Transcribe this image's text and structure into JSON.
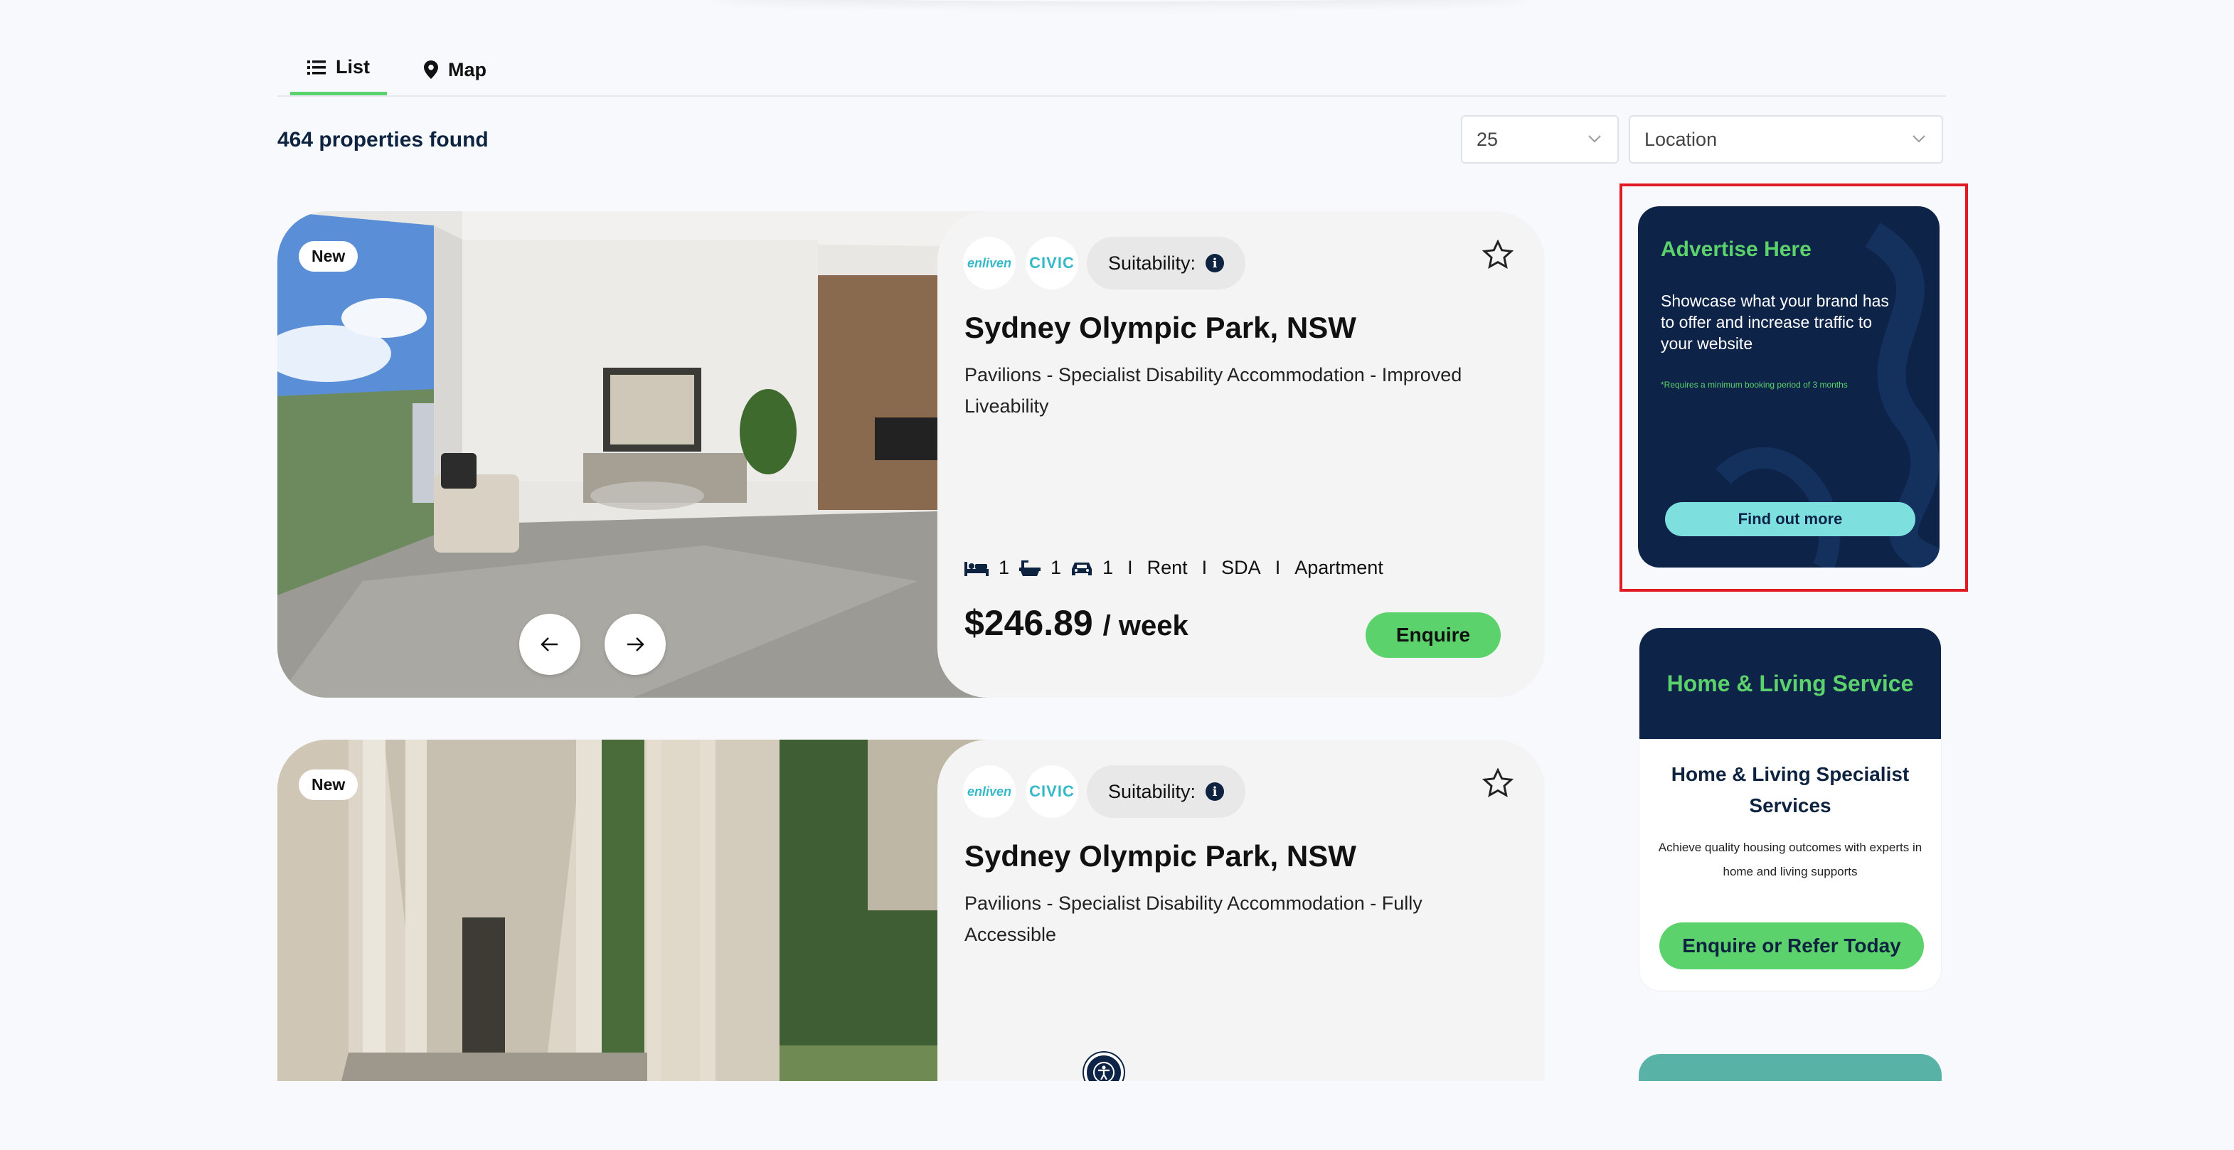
{
  "tabs": [
    {
      "label": "List",
      "icon": "list-icon",
      "active": true
    },
    {
      "label": "Map",
      "icon": "map-pin-icon",
      "active": false
    }
  ],
  "results": {
    "count_text": "464 properties found"
  },
  "filters": {
    "page_size": "25",
    "location_placeholder": "Location"
  },
  "listings": [
    {
      "badge": "New",
      "provider_logos": [
        "enliven",
        "CIVIC"
      ],
      "suitability_label": "Suitability:",
      "title": "Sydney Olympic Park, NSW",
      "description": "Pavilions - Specialist Disability Accommodation - Improved Liveability",
      "beds": "1",
      "baths": "1",
      "cars": "1",
      "tags": [
        "Rent",
        "SDA",
        "Apartment"
      ],
      "price": "$246.89",
      "price_unit": "/ week",
      "cta": "Enquire"
    },
    {
      "badge": "New",
      "provider_logos": [
        "enliven",
        "CIVIC"
      ],
      "suitability_label": "Suitability:",
      "title": "Sydney Olympic Park, NSW",
      "description": "Pavilions - Specialist Disability Accommodation - Fully Accessible"
    }
  ],
  "ads": {
    "advertise": {
      "title": "Advertise Here",
      "body": "Showcase what your brand has to offer and increase traffic to your website",
      "note": "*Requires a minimum booking period of 3 months",
      "cta": "Find out more"
    },
    "home_living": {
      "header": "Home & Living Service",
      "title": "Home & Living Specialist Services",
      "body": "Achieve quality housing outcomes with experts in home and living supports",
      "cta": "Enquire or Refer Today"
    }
  },
  "colors": {
    "accent_green": "#5bd26b",
    "navy": "#0e2348",
    "teal": "#7ee0de",
    "highlight_red": "#e01b24"
  }
}
